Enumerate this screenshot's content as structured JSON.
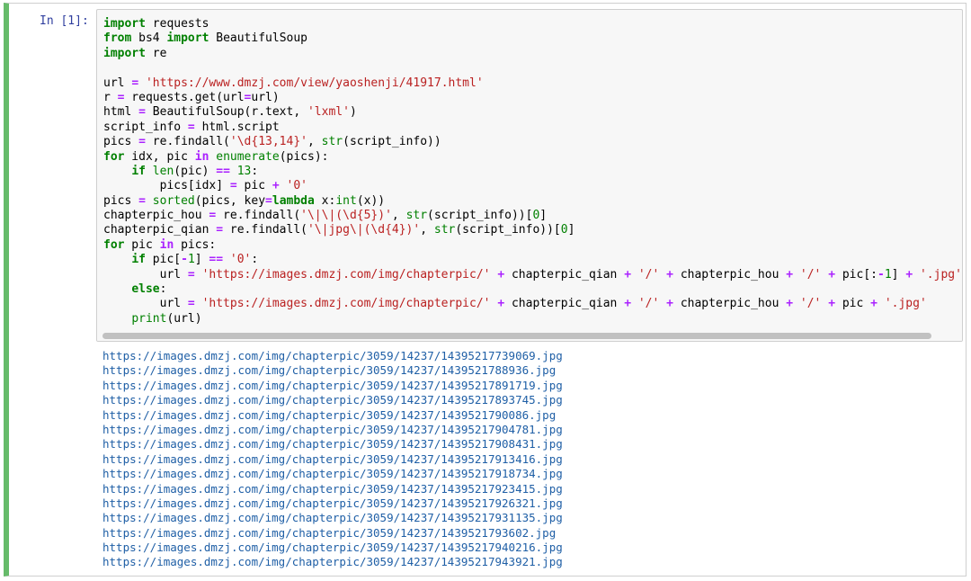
{
  "cell": {
    "prompt": "In [1]:",
    "accent_color": "#66bb6a",
    "code_lines": [
      [
        {
          "t": "import",
          "c": "kw"
        },
        {
          "t": " requests"
        }
      ],
      [
        {
          "t": "from",
          "c": "kw"
        },
        {
          "t": " bs4 "
        },
        {
          "t": "import",
          "c": "kw"
        },
        {
          "t": " BeautifulSoup"
        }
      ],
      [
        {
          "t": "import",
          "c": "kw"
        },
        {
          "t": " re"
        }
      ],
      [],
      [
        {
          "t": "url "
        },
        {
          "t": "=",
          "c": "op"
        },
        {
          "t": " "
        },
        {
          "t": "'https://www.dmzj.com/view/yaoshenji/41917.html'",
          "c": "st"
        }
      ],
      [
        {
          "t": "r "
        },
        {
          "t": "=",
          "c": "op"
        },
        {
          "t": " requests.get(url"
        },
        {
          "t": "=",
          "c": "op"
        },
        {
          "t": "url)"
        }
      ],
      [
        {
          "t": "html "
        },
        {
          "t": "=",
          "c": "op"
        },
        {
          "t": " BeautifulSoup(r.text, "
        },
        {
          "t": "'lxml'",
          "c": "st"
        },
        {
          "t": ")"
        }
      ],
      [
        {
          "t": "script_info "
        },
        {
          "t": "=",
          "c": "op"
        },
        {
          "t": " html.script"
        }
      ],
      [
        {
          "t": "pics "
        },
        {
          "t": "=",
          "c": "op"
        },
        {
          "t": " re.findall("
        },
        {
          "t": "'\\d{13,14}'",
          "c": "st"
        },
        {
          "t": ", "
        },
        {
          "t": "str",
          "c": "bi"
        },
        {
          "t": "(script_info))"
        }
      ],
      [
        {
          "t": "for",
          "c": "kw"
        },
        {
          "t": " idx, pic "
        },
        {
          "t": "in",
          "c": "op"
        },
        {
          "t": " "
        },
        {
          "t": "enumerate",
          "c": "bi"
        },
        {
          "t": "(pics):"
        }
      ],
      [
        {
          "t": "    "
        },
        {
          "t": "if",
          "c": "kw"
        },
        {
          "t": " "
        },
        {
          "t": "len",
          "c": "bi"
        },
        {
          "t": "(pic) "
        },
        {
          "t": "==",
          "c": "op"
        },
        {
          "t": " "
        },
        {
          "t": "13",
          "c": "nu"
        },
        {
          "t": ":"
        }
      ],
      [
        {
          "t": "        pics[idx] "
        },
        {
          "t": "=",
          "c": "op"
        },
        {
          "t": " pic "
        },
        {
          "t": "+",
          "c": "op"
        },
        {
          "t": " "
        },
        {
          "t": "'0'",
          "c": "st"
        }
      ],
      [
        {
          "t": "pics "
        },
        {
          "t": "=",
          "c": "op"
        },
        {
          "t": " "
        },
        {
          "t": "sorted",
          "c": "bi"
        },
        {
          "t": "(pics, key"
        },
        {
          "t": "=",
          "c": "op"
        },
        {
          "t": "lambda",
          "c": "kw"
        },
        {
          "t": " x:"
        },
        {
          "t": "int",
          "c": "bi"
        },
        {
          "t": "(x))"
        }
      ],
      [
        {
          "t": "chapterpic_hou "
        },
        {
          "t": "=",
          "c": "op"
        },
        {
          "t": " re.findall("
        },
        {
          "t": "'\\|\\|(\\d{5})'",
          "c": "st"
        },
        {
          "t": ", "
        },
        {
          "t": "str",
          "c": "bi"
        },
        {
          "t": "(script_info))["
        },
        {
          "t": "0",
          "c": "nu"
        },
        {
          "t": "]"
        }
      ],
      [
        {
          "t": "chapterpic_qian "
        },
        {
          "t": "=",
          "c": "op"
        },
        {
          "t": " re.findall("
        },
        {
          "t": "'\\|jpg\\|(\\d{4})'",
          "c": "st"
        },
        {
          "t": ", "
        },
        {
          "t": "str",
          "c": "bi"
        },
        {
          "t": "(script_info))["
        },
        {
          "t": "0",
          "c": "nu"
        },
        {
          "t": "]"
        }
      ],
      [
        {
          "t": "for",
          "c": "kw"
        },
        {
          "t": " pic "
        },
        {
          "t": "in",
          "c": "op"
        },
        {
          "t": " pics:"
        }
      ],
      [
        {
          "t": "    "
        },
        {
          "t": "if",
          "c": "kw"
        },
        {
          "t": " pic["
        },
        {
          "t": "-",
          "c": "op"
        },
        {
          "t": "1",
          "c": "nu"
        },
        {
          "t": "] "
        },
        {
          "t": "==",
          "c": "op"
        },
        {
          "t": " "
        },
        {
          "t": "'0'",
          "c": "st"
        },
        {
          "t": ":"
        }
      ],
      [
        {
          "t": "        url "
        },
        {
          "t": "=",
          "c": "op"
        },
        {
          "t": " "
        },
        {
          "t": "'https://images.dmzj.com/img/chapterpic/'",
          "c": "st"
        },
        {
          "t": " "
        },
        {
          "t": "+",
          "c": "op"
        },
        {
          "t": " chapterpic_qian "
        },
        {
          "t": "+",
          "c": "op"
        },
        {
          "t": " "
        },
        {
          "t": "'/'",
          "c": "st"
        },
        {
          "t": " "
        },
        {
          "t": "+",
          "c": "op"
        },
        {
          "t": " chapterpic_hou "
        },
        {
          "t": "+",
          "c": "op"
        },
        {
          "t": " "
        },
        {
          "t": "'/'",
          "c": "st"
        },
        {
          "t": " "
        },
        {
          "t": "+",
          "c": "op"
        },
        {
          "t": " pic[:"
        },
        {
          "t": "-",
          "c": "op"
        },
        {
          "t": "1",
          "c": "nu"
        },
        {
          "t": "] "
        },
        {
          "t": "+",
          "c": "op"
        },
        {
          "t": " "
        },
        {
          "t": "'.jpg'",
          "c": "st"
        }
      ],
      [
        {
          "t": "    "
        },
        {
          "t": "else",
          "c": "kw"
        },
        {
          "t": ":"
        }
      ],
      [
        {
          "t": "        url "
        },
        {
          "t": "=",
          "c": "op"
        },
        {
          "t": " "
        },
        {
          "t": "'https://images.dmzj.com/img/chapterpic/'",
          "c": "st"
        },
        {
          "t": " "
        },
        {
          "t": "+",
          "c": "op"
        },
        {
          "t": " chapterpic_qian "
        },
        {
          "t": "+",
          "c": "op"
        },
        {
          "t": " "
        },
        {
          "t": "'/'",
          "c": "st"
        },
        {
          "t": " "
        },
        {
          "t": "+",
          "c": "op"
        },
        {
          "t": " chapterpic_hou "
        },
        {
          "t": "+",
          "c": "op"
        },
        {
          "t": " "
        },
        {
          "t": "'/'",
          "c": "st"
        },
        {
          "t": " "
        },
        {
          "t": "+",
          "c": "op"
        },
        {
          "t": " pic "
        },
        {
          "t": "+",
          "c": "op"
        },
        {
          "t": " "
        },
        {
          "t": "'.jpg'",
          "c": "st"
        }
      ],
      [
        {
          "t": "    "
        },
        {
          "t": "print",
          "c": "bi"
        },
        {
          "t": "(url)"
        }
      ]
    ],
    "output_lines": [
      "https://images.dmzj.com/img/chapterpic/3059/14237/14395217739069.jpg",
      "https://images.dmzj.com/img/chapterpic/3059/14237/1439521788936.jpg",
      "https://images.dmzj.com/img/chapterpic/3059/14237/14395217891719.jpg",
      "https://images.dmzj.com/img/chapterpic/3059/14237/14395217893745.jpg",
      "https://images.dmzj.com/img/chapterpic/3059/14237/1439521790086.jpg",
      "https://images.dmzj.com/img/chapterpic/3059/14237/14395217904781.jpg",
      "https://images.dmzj.com/img/chapterpic/3059/14237/14395217908431.jpg",
      "https://images.dmzj.com/img/chapterpic/3059/14237/14395217913416.jpg",
      "https://images.dmzj.com/img/chapterpic/3059/14237/14395217918734.jpg",
      "https://images.dmzj.com/img/chapterpic/3059/14237/14395217923415.jpg",
      "https://images.dmzj.com/img/chapterpic/3059/14237/14395217926321.jpg",
      "https://images.dmzj.com/img/chapterpic/3059/14237/14395217931135.jpg",
      "https://images.dmzj.com/img/chapterpic/3059/14237/1439521793602.jpg",
      "https://images.dmzj.com/img/chapterpic/3059/14237/14395217940216.jpg",
      "https://images.dmzj.com/img/chapterpic/3059/14237/14395217943921.jpg"
    ]
  }
}
